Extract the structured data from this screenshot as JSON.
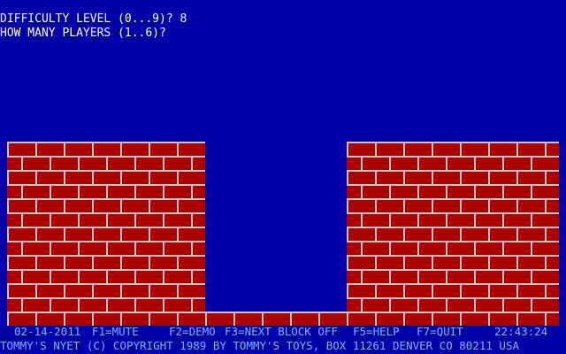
{
  "prompts": {
    "difficulty": "DIFFICULTY LEVEL (0...9)? 8",
    "players": "HOW MANY PLAYERS (1..6)?"
  },
  "status_bar": {
    "date": "02-14-2011",
    "f1": "F1=MUTE",
    "f2": "F2=DEMO",
    "f3": "F3=NEXT BLOCK OFF",
    "f5": "F5=HELP",
    "f7": "F7=QUIT",
    "time": "22:43:24"
  },
  "copyright": "TOMMY'S NYET (C) COPYRIGHT 1989 BY TOMMY'S TOYS, BOX 11261 DENVER CO 80211 USA",
  "colors": {
    "background": "#0000aa",
    "brick": "#aa0000",
    "mortar": "#c8c8c8",
    "status_text": "#7fb4ff",
    "prompt_text": "#ffffff"
  }
}
